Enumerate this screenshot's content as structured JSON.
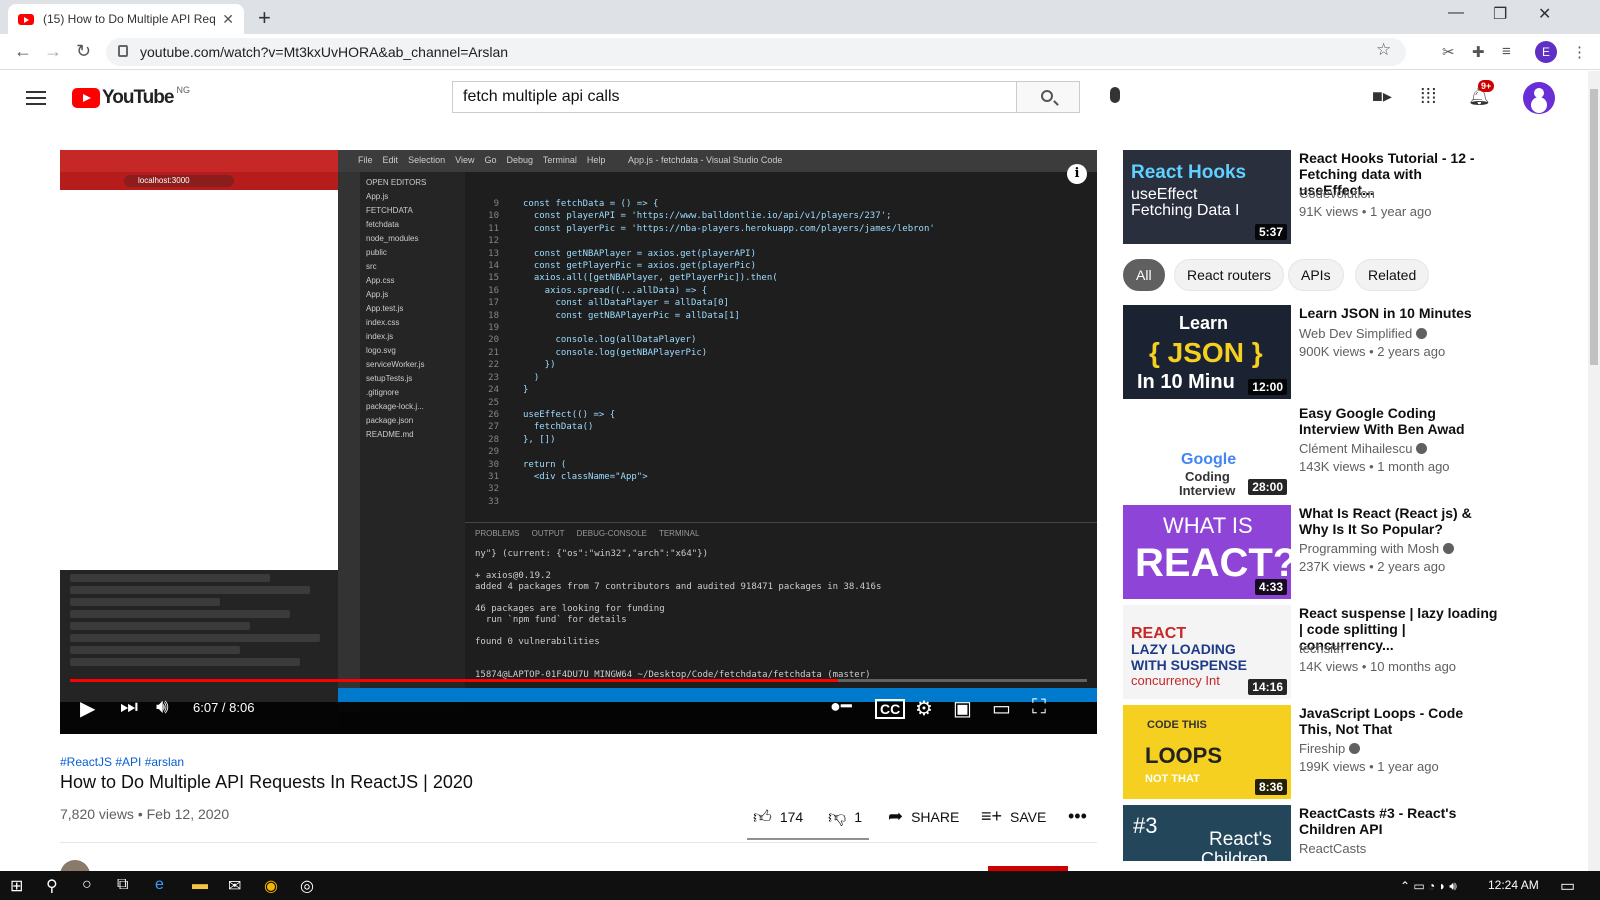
{
  "browser": {
    "tab_title": "(15) How to Do Multiple API Req",
    "url": "youtube.com/watch?v=Mt3kxUvHORA&ab_channel=Arslan",
    "profile_initial": "E"
  },
  "header": {
    "logo_text": "YouTube",
    "country_code": "NG",
    "search_value": "fetch multiple api calls",
    "notifications_badge": "9+"
  },
  "player": {
    "current_time": "6:07",
    "duration": "8:06",
    "time_display": "6:07 / 8:06",
    "progress": 0.755,
    "menu_items": [
      "File",
      "Edit",
      "Selection",
      "View",
      "Go",
      "Debug",
      "Terminal",
      "Help"
    ],
    "editor_title": "App.js - fetchdata - Visual Studio Code",
    "browser_address": "localhost:3000",
    "explorer_items": [
      "OPEN EDITORS",
      "App.js",
      "FETCHDATA",
      "fetchdata",
      "node_modules",
      "public",
      "src",
      "App.css",
      "App.js",
      "App.test.js",
      "index.css",
      "index.js",
      "logo.svg",
      "serviceWorker.js",
      "setupTests.js",
      ".gitignore",
      "package-lock.j...",
      "package.json",
      "README.md"
    ],
    "code_lines": [
      "const fetchData = () => {",
      "  const playerAPI = 'https://www.balldontlie.io/api/v1/players/237';",
      "  const playerPic = 'https://nba-players.herokuapp.com/players/james/lebron'",
      "",
      "  const getNBAPlayer = axios.get(playerAPI)",
      "  const getPlayerPic = axios.get(playerPic)",
      "  axios.all([getNBAPlayer, getPlayerPic]).then(",
      "    axios.spread((...allData) => {",
      "      const allDataPlayer = allData[0]",
      "      const getNBAPlayerPic = allData[1]",
      "",
      "      console.log(allDataPlayer)",
      "      console.log(getNBAPlayerPic)",
      "    })",
      "  )",
      "}",
      "",
      "useEffect(() => {",
      "  fetchData()",
      "}, [])",
      "",
      "return (",
      "  <div className=\"App\">"
    ],
    "line_numbers": "9\n10\n11\n12\n13\n14\n15\n16\n17\n18\n19\n20\n21\n22\n23\n24\n25\n26\n27\n28\n29\n30\n31\n32\n33",
    "terminal_tabs": "PROBLEMS OUTPUT DEBUG-CONSOLE TERMINAL",
    "terminal_lines": [
      "ny\"} (current: {\"os\":\"win32\",\"arch\":\"x64\"})",
      "",
      "+ axios@0.19.2",
      "added 4 packages from 7 contributors and audited 918471 packages in 38.416s",
      "",
      "46 packages are looking for funding",
      "  run `npm fund` for details",
      "",
      "found 0 vulnerabilities",
      "",
      "",
      "15874@LAPTOP-01F4DU7U MINGW64 ~/Desktop/Code/fetchdata/fetchdata (master)"
    ]
  },
  "video": {
    "hashtags": "#ReactJS #API #arslan",
    "title": "How to Do Multiple API Requests In ReactJS | 2020",
    "views": "7,820 views",
    "date": "Feb 12, 2020",
    "meta": "7,820 views • Feb 12, 2020",
    "likes": "174",
    "dislikes": "1",
    "share": "SHARE",
    "save": "SAVE"
  },
  "chips": [
    "All",
    "React routers",
    "APIs",
    "Related"
  ],
  "recommendations": [
    {
      "title": "React Hooks Tutorial - 12 - Fetching data with useEffect...",
      "channel": "Codevolution",
      "meta": "91K views • 1 year ago",
      "duration": "5:37",
      "thumb_text": [
        "React Hooks",
        "useEffect",
        "Fetching Data I"
      ],
      "verified": false,
      "color": "#2a2f3e"
    },
    {
      "title": "Learn JSON in 10 Minutes",
      "channel": "Web Dev Simplified",
      "meta": "900K views • 2 years ago",
      "duration": "12:00",
      "thumb_text": [
        "Learn",
        "{ JSON }",
        "In 10 Minu"
      ],
      "verified": true,
      "color": "#1b2333"
    },
    {
      "title": "Easy Google Coding Interview With Ben Awad",
      "channel": "Clément Mihailescu",
      "meta": "143K views • 1 month ago",
      "duration": "28:00",
      "thumb_text": [
        "Google",
        "Coding",
        "Interview"
      ],
      "verified": true,
      "color": "#ffffff"
    },
    {
      "title": "What Is React (React js) & Why Is It So Popular?",
      "channel": "Programming with Mosh",
      "meta": "237K views • 2 years ago",
      "duration": "4:33",
      "thumb_text": [
        "WHAT IS",
        "REACT?"
      ],
      "verified": true,
      "color": "#8e44d6"
    },
    {
      "title": "React suspense | lazy loading | code splitting | concurrency...",
      "channel": "techsith",
      "meta": "14K views • 10 months ago",
      "duration": "14:16",
      "thumb_text": [
        "REACT",
        "LAZY LOADING",
        "WITH SUSPENSE",
        "concurrency Int"
      ],
      "verified": false,
      "color": "#f4f4f4"
    },
    {
      "title": "JavaScript Loops - Code This, Not That",
      "channel": "Fireship",
      "meta": "199K views • 1 year ago",
      "duration": "8:36",
      "thumb_text": [
        "CODE THIS",
        "LOOPS",
        "NOT THAT"
      ],
      "verified": true,
      "color": "#f5d020"
    },
    {
      "title": "ReactCasts #3 - React's Children API",
      "channel": "ReactCasts",
      "meta": "",
      "duration": "",
      "thumb_text": [
        "#3",
        "React's",
        "Children API"
      ],
      "verified": false,
      "color": "#24465b"
    }
  ],
  "taskbar": {
    "time": "12:24 AM"
  }
}
